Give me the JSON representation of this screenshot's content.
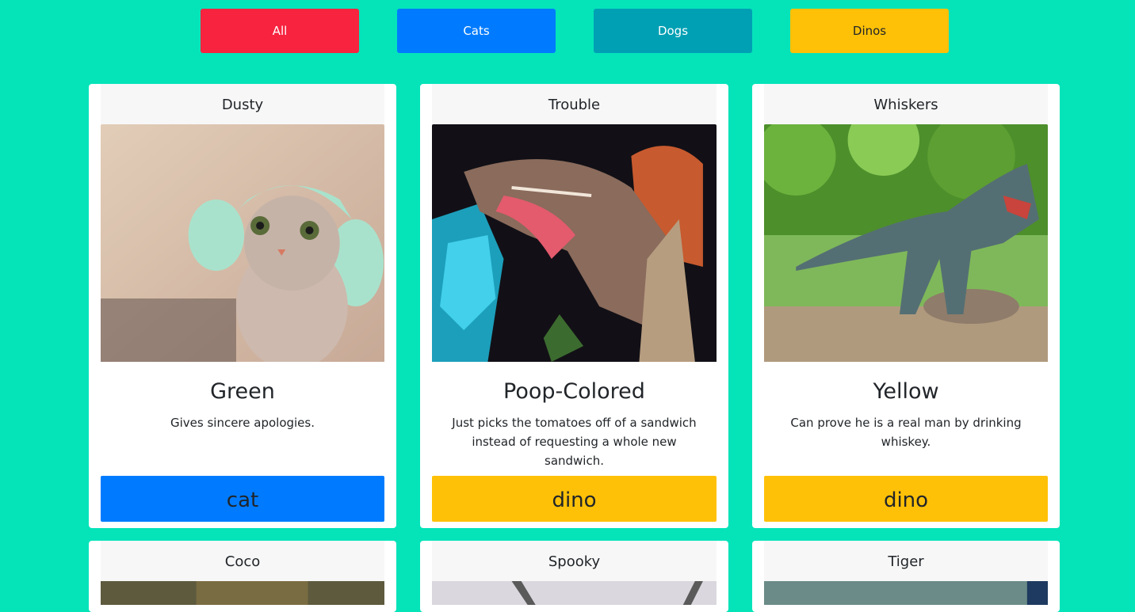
{
  "filters": [
    {
      "label": "All"
    },
    {
      "label": "Cats"
    },
    {
      "label": "Dogs"
    },
    {
      "label": "Dinos"
    }
  ],
  "cards": [
    {
      "name": "Dusty",
      "color": "Green",
      "text": "Gives sincere apologies.",
      "type": "cat"
    },
    {
      "name": "Trouble",
      "color": "Poop-Colored",
      "text": "Just picks the tomatoes off of a sandwich instead of requesting a whole new sandwich.",
      "type": "dino"
    },
    {
      "name": "Whiskers",
      "color": "Yellow",
      "text": "Can prove he is a real man by drinking whiskey.",
      "type": "dino"
    }
  ],
  "partial_cards": [
    {
      "name": "Coco"
    },
    {
      "name": "Spooky"
    },
    {
      "name": "Tiger"
    }
  ],
  "colors": {
    "background": "#05e3b9",
    "all": "#f7233f",
    "cats": "#007bff",
    "dogs": "#00a0b4",
    "dinos": "#ffc107"
  }
}
